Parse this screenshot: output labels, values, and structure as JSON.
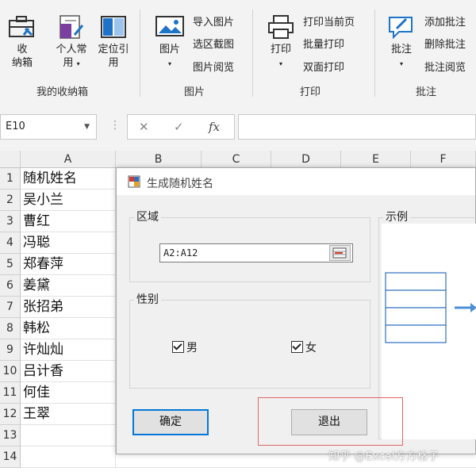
{
  "ribbon": {
    "groups": [
      {
        "label": "我的收纳箱"
      },
      {
        "label": "图片"
      },
      {
        "label": "打印"
      },
      {
        "label": "批注"
      }
    ],
    "buttons": {
      "toolbox": "收\n纳箱",
      "personal": "个人常\n用",
      "locate": "定位引\n用",
      "picture": "图片",
      "print": "打印",
      "comment": "批注"
    },
    "picture_items": [
      "导入图片",
      "选区截图",
      "图片阅览"
    ],
    "print_items": [
      "打印当前页",
      "批量打印",
      "双面打印"
    ],
    "comment_items": [
      "添加批注",
      "删除批注",
      "批注阅览"
    ]
  },
  "formula_bar": {
    "name_box": "E10",
    "fx": "fx",
    "cancel": "✕",
    "confirm": "✓",
    "formula": ""
  },
  "sheet": {
    "columns": [
      "A",
      "B",
      "C",
      "D",
      "E",
      "F"
    ],
    "rows": [
      {
        "num": "1",
        "a": "随机姓名"
      },
      {
        "num": "2",
        "a": "吴小兰"
      },
      {
        "num": "3",
        "a": "曹红"
      },
      {
        "num": "4",
        "a": "冯聪"
      },
      {
        "num": "5",
        "a": "郑春萍"
      },
      {
        "num": "6",
        "a": "姜黛"
      },
      {
        "num": "7",
        "a": "张招弟"
      },
      {
        "num": "8",
        "a": "韩松"
      },
      {
        "num": "9",
        "a": "许灿灿"
      },
      {
        "num": "10",
        "a": "吕计香"
      },
      {
        "num": "11",
        "a": "何佳"
      },
      {
        "num": "12",
        "a": "王翠"
      },
      {
        "num": "13",
        "a": ""
      },
      {
        "num": "14",
        "a": ""
      }
    ]
  },
  "dialog": {
    "title": "生成随机姓名",
    "range_label": "区域",
    "range_value": "A2:A12",
    "gender_label": "性别",
    "male": "男",
    "female": "女",
    "example_label": "示例",
    "ok_button": "确定",
    "exit_button": "退出"
  },
  "watermark": "知乎 @Excel方方格子",
  "colors": {
    "accent": "#0078d7",
    "highlight_box": "#e06666",
    "ribbon_bg": "#f3f3f3"
  }
}
